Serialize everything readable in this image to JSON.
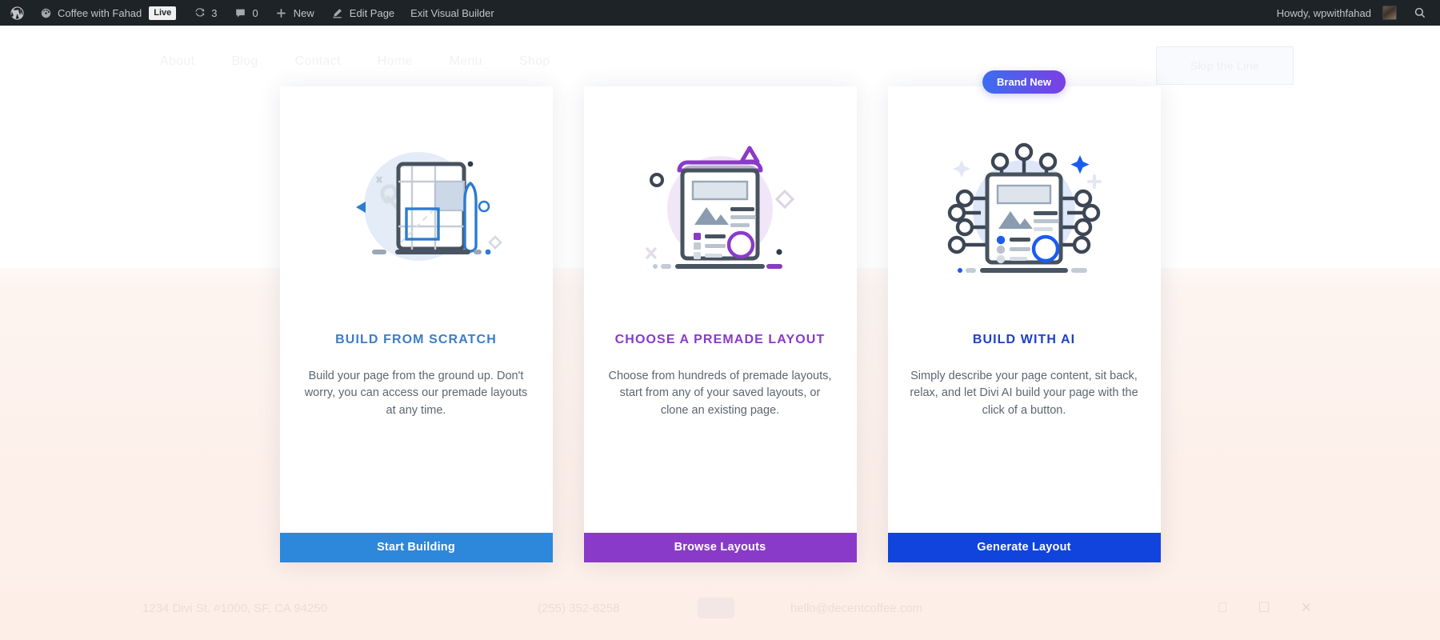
{
  "adminbar": {
    "wp_logo_icon": "wordpress-logo-icon",
    "site_name": "Coffee with Fahad",
    "site_icon": "dashboard-icon",
    "live_label": "Live",
    "updates_icon": "updates-icon",
    "updates_count": "3",
    "comments_icon": "comment-bubble-icon",
    "comments_count": "0",
    "new_icon": "plus-icon",
    "new_label": "New",
    "edit_icon": "pencil-icon",
    "edit_label": "Edit Page",
    "exit_label": "Exit Visual Builder",
    "howdy": "Howdy, wpwithfahad",
    "avatar_icon": "user-avatar",
    "search_icon": "search-icon",
    "bg_color": "#1d2327"
  },
  "background_page": {
    "nav": [
      "About",
      "Blog",
      "Contact",
      "Home",
      "Menu",
      "Shop"
    ],
    "skip_button": "Skip the Line",
    "footer": {
      "address": "1234 Divi St. #1000, SF, CA 94250",
      "phone": "(255) 352-6258",
      "email": "hello@decentcoffee.com",
      "social": [
        "facebook-icon",
        "instagram-icon",
        "x-twitter-icon"
      ]
    }
  },
  "cards": [
    {
      "id": "build-from-scratch",
      "title": "BUILD FROM SCRATCH",
      "title_color": "#3d7cc9",
      "description": "Build your page from the ground up. Don't worry, you can access our premade layouts at any time.",
      "button_label": "Start Building",
      "button_color": "#2d87da",
      "illustration": "blueprint-grid-pencil-illustration",
      "badge": null
    },
    {
      "id": "choose-premade-layout",
      "title": "CHOOSE A PREMADE LAYOUT",
      "title_color": "#8a3ac8",
      "description": "Choose from hundreds of premade layouts, start from any of your saved layouts, or clone an existing page.",
      "button_label": "Browse Layouts",
      "button_color": "#8a3ac8",
      "illustration": "premade-layout-page-illustration",
      "badge": null
    },
    {
      "id": "build-with-ai",
      "title": "BUILD WITH AI",
      "title_color": "#2040c8",
      "description": "Simply describe your page content, sit back, relax, and let Divi AI build your page with the click of a button.",
      "button_label": "Generate Layout",
      "button_color": "#1144dd",
      "illustration": "ai-circuit-page-illustration",
      "badge": "Brand New"
    }
  ]
}
